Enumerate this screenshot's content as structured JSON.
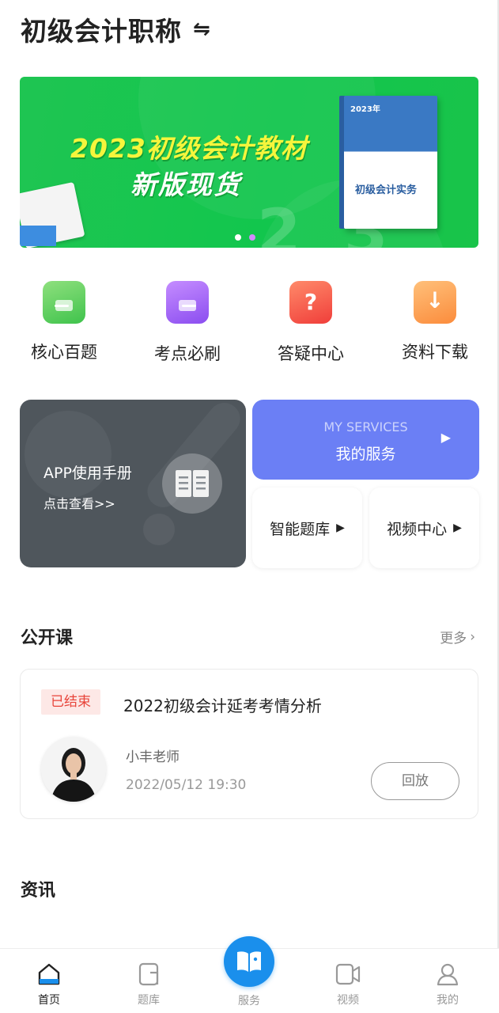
{
  "header": {
    "title": "初级会计职称",
    "swap_icon": "⇋"
  },
  "banner": {
    "headline": "2023初级会计教材",
    "subline": "新版现货",
    "book_year": "2023年",
    "book_title": "初级会计实务",
    "slides_total": 2,
    "active_slide": 2,
    "colors": {
      "bg": "#12c64d",
      "headline": "#f5f53c",
      "active_dot": "#d28cff"
    }
  },
  "quick_links": [
    {
      "label": "核心百题",
      "icon": "card-icon"
    },
    {
      "label": "考点必刷",
      "icon": "wallet-icon"
    },
    {
      "label": "答疑中心",
      "icon": "question-icon"
    },
    {
      "label": "资料下载",
      "icon": "download-icon"
    }
  ],
  "manual_card": {
    "title": "APP使用手册",
    "link": "点击查看>>",
    "icon": "book-icon"
  },
  "my_services": {
    "en": "MY SERVICES",
    "cn": "我的服务",
    "color": "#6b7ff5"
  },
  "small_cards": [
    {
      "label": "智能题库"
    },
    {
      "label": "视频中心"
    }
  ],
  "open_course": {
    "section_title": "公开课",
    "more": "更多",
    "course": {
      "status": "已结束",
      "title": "2022初级会计延考考情分析",
      "teacher": "小丰老师",
      "datetime": "2022/05/12 19:30",
      "action": "回放"
    }
  },
  "news": {
    "section_title": "资讯"
  },
  "tabbar": {
    "items": [
      {
        "label": "首页",
        "icon": "home-icon",
        "active": true
      },
      {
        "label": "题库",
        "icon": "question-bank-icon",
        "active": false
      },
      {
        "label": "服务",
        "icon": "book-icon",
        "active": false
      },
      {
        "label": "视频",
        "icon": "video-icon",
        "active": false
      },
      {
        "label": "我的",
        "icon": "user-icon",
        "active": false
      }
    ],
    "center_color": "#1a8fec"
  }
}
